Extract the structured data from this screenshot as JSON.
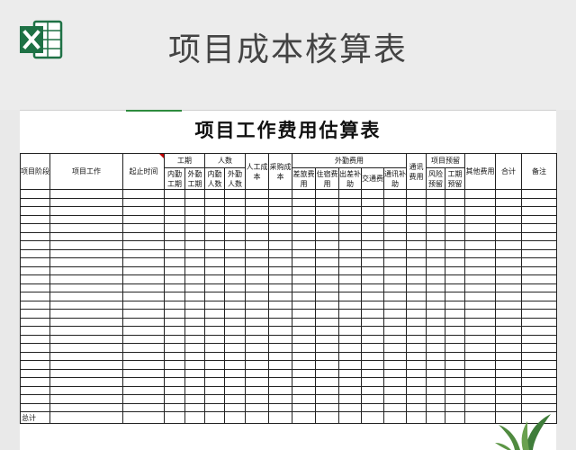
{
  "banner": {
    "title": "项目成本核算表",
    "icon": "excel-icon",
    "icon_color": "#1e7145"
  },
  "sheet": {
    "title": "项目工作费用估算表",
    "table": {
      "headers": {
        "stage": "项目阶段",
        "work": "项目工作",
        "period": "起止时间",
        "duration": "工期",
        "duration_internal": "内勤工期",
        "duration_external": "外勤工期",
        "headcount": "人数",
        "headcount_internal": "内勤人数",
        "headcount_external": "外勤人数",
        "labor_cost": "人工成本",
        "purchase_cost": "采购成本",
        "field_expenses": "外勤费用",
        "travel_cost": "差旅费用",
        "lodging_cost": "住宿费用",
        "travel_allowance": "出差补助",
        "transport_cost": "交通费",
        "comm_allowance": "通讯补助",
        "comm_cost": "通讯费用",
        "reserve": "项目预留",
        "risk_reserve": "风险预留",
        "duration_reserve": "工期预留",
        "other_cost": "其他费用",
        "total": "合计",
        "remarks": "备注"
      },
      "total_label": "总计"
    }
  },
  "decor": {
    "plant": "plant-decoration",
    "green": "#3f7d3a"
  }
}
